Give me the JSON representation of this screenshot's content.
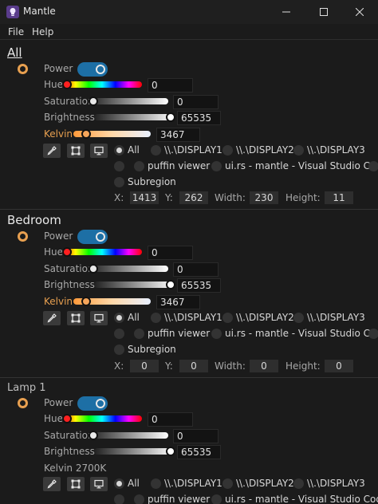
{
  "window": {
    "title": "Mantle"
  },
  "menu": {
    "file": "File",
    "help": "Help"
  },
  "labels": {
    "power": "Power",
    "hue": "Hue",
    "saturation": "Saturation",
    "brightness": "Brightness",
    "kelvin": "Kelvin"
  },
  "displays": {
    "all": "All",
    "d1": "\\\\.\\DISPLAY1",
    "d2": "\\\\.\\DISPLAY2",
    "d3": "\\\\.\\DISPLAY3",
    "puffin": "puffin viewer",
    "vscode": "ui.rs - mantle - Visual Studio Code",
    "subregion": "Subregion"
  },
  "region_labels": {
    "x": "X:",
    "y": "Y:",
    "width": "Width:",
    "height": "Height:"
  },
  "groups": [
    {
      "name": "All",
      "power": true,
      "hue": 0,
      "saturation": 0,
      "brightness": 65535,
      "kelvin": 3467,
      "hue_frac": 0.0,
      "sat_frac": 0.0,
      "bri_frac": 1.0,
      "kel_frac": 0.12,
      "region": {
        "x": "1413",
        "y": "262",
        "width": "230",
        "height": "11"
      }
    },
    {
      "name": "Bedroom",
      "power": true,
      "hue": 0,
      "saturation": 0,
      "brightness": 65535,
      "kelvin": 3467,
      "hue_frac": 0.0,
      "sat_frac": 0.0,
      "bri_frac": 1.0,
      "kel_frac": 0.12,
      "region": {
        "x": "0",
        "y": "0",
        "width": "0",
        "height": "0"
      }
    },
    {
      "name": "Lamp 1",
      "power": true,
      "hue": 0,
      "saturation": 0,
      "brightness": 65535,
      "kelvin_text": "Kelvin  2700K",
      "hue_frac": 0.0,
      "sat_frac": 0.0,
      "bri_frac": 1.0
    }
  ],
  "colors": {
    "accent": "#1d6fa5",
    "bulb": "#e8a050",
    "background": "#1b1b1b"
  }
}
